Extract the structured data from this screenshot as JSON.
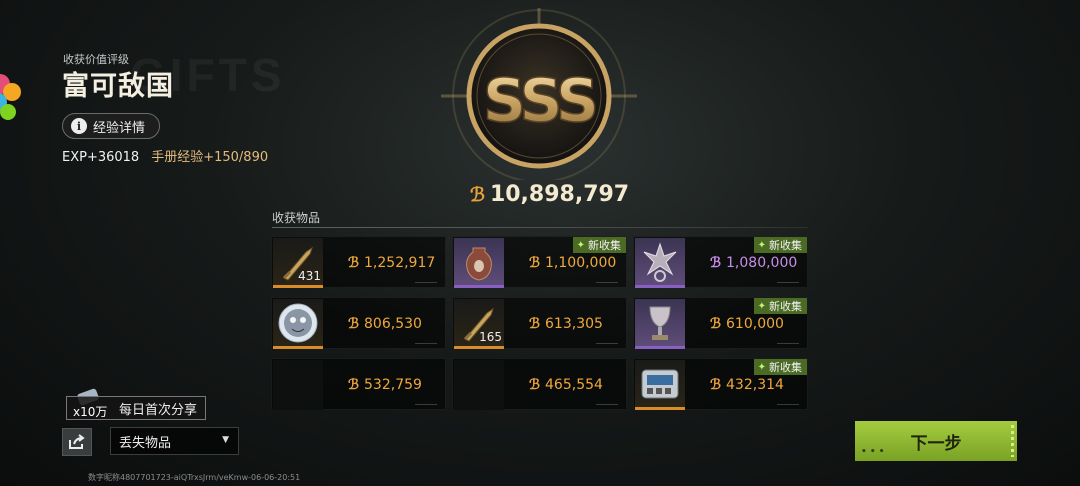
{
  "background_text": "GIFTS",
  "rating": {
    "caption": "收获价值评级",
    "title": "富可敌国",
    "grade": "SSS",
    "exp_details_label": "经验详情",
    "exp_gain": "EXP+36018",
    "manual_exp": "手册经验+150/890"
  },
  "total_value": "10,898,797",
  "section_label": "收获物品",
  "new_tag_label": "新收集",
  "items": [
    {
      "value": "1,252,917",
      "count": "431",
      "rarity": "gold",
      "is_new": false,
      "icon": "bullet-icon"
    },
    {
      "value": "1,100,000",
      "count": "",
      "rarity": "purple",
      "is_new": true,
      "icon": "vase-icon"
    },
    {
      "value": "1,080,000",
      "count": "",
      "rarity": "purple",
      "is_new": true,
      "icon": "ornament-icon"
    },
    {
      "value": "806,530",
      "count": "",
      "rarity": "gold",
      "is_new": false,
      "icon": "plate-icon"
    },
    {
      "value": "613,305",
      "count": "165",
      "rarity": "gold",
      "is_new": false,
      "icon": "bullet-icon"
    },
    {
      "value": "610,000",
      "count": "",
      "rarity": "purple",
      "is_new": true,
      "icon": "trophy-icon"
    },
    {
      "value": "532,759",
      "count": "",
      "rarity": "empty",
      "is_new": false,
      "icon": ""
    },
    {
      "value": "465,554",
      "count": "",
      "rarity": "empty",
      "is_new": false,
      "icon": ""
    },
    {
      "value": "432,314",
      "count": "",
      "rarity": "gold",
      "is_new": true,
      "icon": "device-icon"
    }
  ],
  "share": {
    "reward_count": "x10万",
    "tip_text": "每日首次分享"
  },
  "lost_items_select": "丢失物品",
  "next_button": "下一步",
  "footer_id": "数字昵称4807701723-aiQTrxsJrm/veKmw-06-06-20:51",
  "colors": {
    "accent_gold": "#f0a83c",
    "purple": "#c98ce8",
    "next_green": "#8fb832",
    "new_tag": "#4b6b25"
  }
}
